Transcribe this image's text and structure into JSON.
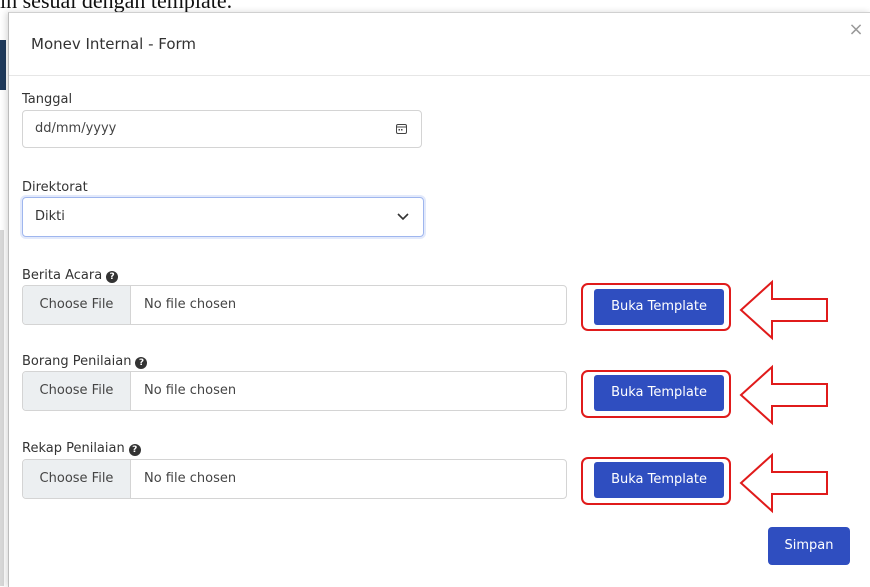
{
  "background": {
    "partial_text": "ih sesuai dengan template."
  },
  "modal": {
    "title": "Monev Internal - Form",
    "close_icon": "close-icon"
  },
  "form": {
    "tanggal": {
      "label": "Tanggal",
      "placeholder": "dd/mm/yyyy",
      "icon": "calendar-icon"
    },
    "direktorat": {
      "label": "Direktorat",
      "selected": "Dikti",
      "icon": "chevron-down-icon"
    },
    "uploads": [
      {
        "label": "Berita Acara",
        "choose_label": "Choose File",
        "status": "No file chosen",
        "template_button": "Buka Template"
      },
      {
        "label": "Borang Penilaian",
        "choose_label": "Choose File",
        "status": "No file chosen",
        "template_button": "Buka Template"
      },
      {
        "label": "Rekap Penilaian",
        "choose_label": "Choose File",
        "status": "No file chosen",
        "template_button": "Buka Template"
      }
    ],
    "help_icon": "question-circle-icon",
    "submit_label": "Simpan"
  },
  "annotations": {
    "highlight_color": "#e01b1b",
    "arrow_color": "#e01b1b"
  },
  "colors": {
    "primary": "#2f4ec0",
    "choose_bg": "#eceff1"
  }
}
